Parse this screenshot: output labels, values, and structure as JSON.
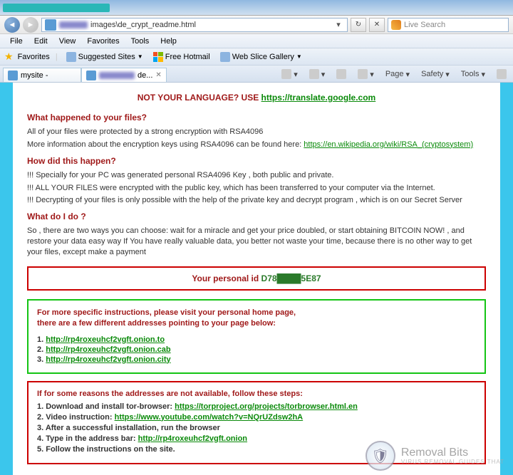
{
  "titlebar": {
    "title_hidden": true
  },
  "address": {
    "path": "images\\de_crypt_readme.html",
    "search_placeholder": "Live Search"
  },
  "menu": {
    "file": "File",
    "edit": "Edit",
    "view": "View",
    "favorites": "Favorites",
    "tools": "Tools",
    "help": "Help"
  },
  "favbar": {
    "label": "Favorites",
    "suggested": "Suggested Sites",
    "hotmail": "Free Hotmail",
    "webslice": "Web Slice Gallery"
  },
  "tabs": {
    "inactive": "mysite -",
    "active": "de..."
  },
  "toolbar": {
    "page": "Page",
    "safety": "Safety",
    "tools": "Tools"
  },
  "doc": {
    "lang_prefix": "NOT YOUR LANGUAGE? USE ",
    "lang_link": "https://translate.google.com",
    "h1": "What happened to your files?",
    "p1": "All of your files were protected by a strong encryption with RSA4096",
    "p2a": "More information about the encryption keys using RSA4096 can be found here: ",
    "p2link": "https://en.wikipedia.org/wiki/RSA_(cryptosystem)",
    "h2": "How did this happen?",
    "p3": "!!! Specially for your PC was generated personal RSA4096 Key , both public and private.",
    "p4": "!!! ALL YOUR FILES were encrypted with the public key, which has been transferred to your computer via the Internet.",
    "p5": "!!! Decrypting of your files is only possible with the help of the private key and decrypt program , which is on our Secret Server",
    "h3": "What do I do ?",
    "p6": "So , there are two ways you can choose: wait for a miracle and get your price doubled, or start obtaining BITCOIN NOW! , and restore your data easy way If You have really valuable data, you better not waste your time, because there is no other way to get your files, except make a payment",
    "id_label": "Your personal id ",
    "id_value": "D78████5E87",
    "green_lead1": "For more specific instructions, please visit your personal home page,",
    "green_lead2": "there are a few different addresses pointing to your page below:",
    "links": [
      "http://rp4roxeuhcf2vgft.onion.to",
      "http://rp4roxeuhcf2vgft.onion.cab",
      "http://rp4roxeuhcf2vgft.onion.city"
    ],
    "red_lead": "If for some reasons the addresses are not available, follow these steps:",
    "red1a": "1. Download and install tor-browser: ",
    "red1link": "https://torproject.org/projects/torbrowser.html.en",
    "red2a": "2. Video instruction: ",
    "red2link": "https://www.youtube.com/watch?v=NQrUZdsw2hA",
    "red3": "3. After a successful installation, run the browser",
    "red4a": "4. Type in the address bar: ",
    "red4link": "http://rp4roxeuhcf2vgft.onion",
    "red5": "5. Follow the instructions on the site."
  },
  "watermark": {
    "title": "Removal Bits",
    "sub": "VIRUS REMOVAL GUIDES THAT"
  }
}
